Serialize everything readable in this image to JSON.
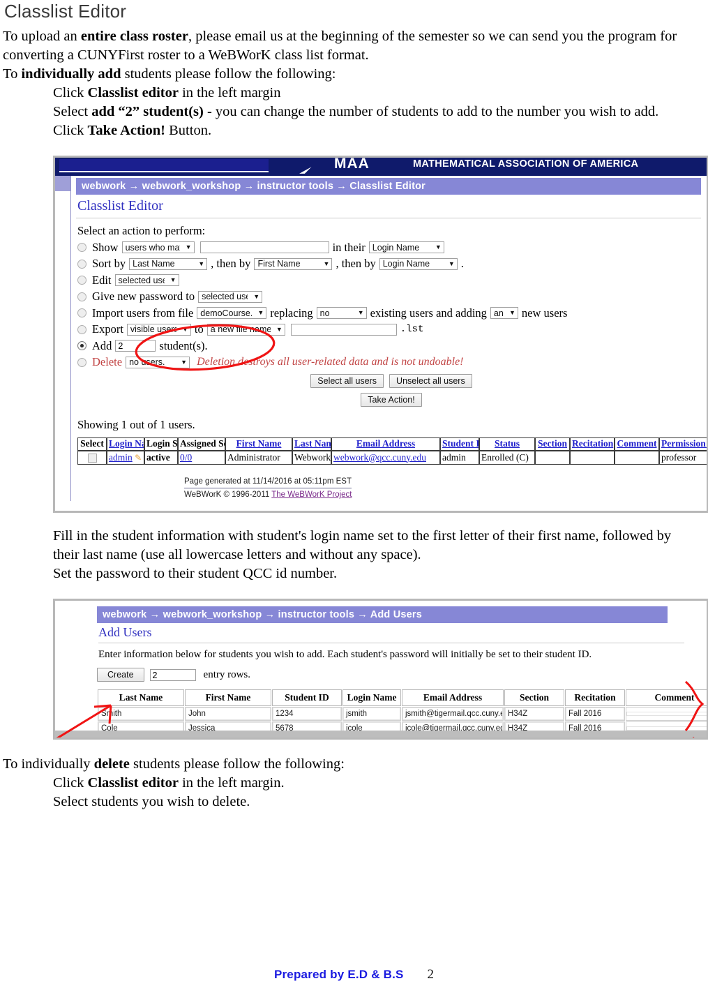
{
  "document": {
    "title": "Classlist Editor",
    "paragraphs": [
      {
        "id": "p1",
        "segments": [
          {
            "text": "To upload an ",
            "bold": false
          },
          {
            "text": "entire class roster",
            "bold": true
          },
          {
            "text": ", please email us at the beginning of the semester so we can send you the program for converting a CUNYFirst roster to a WeBWorK class list format.",
            "bold": false
          }
        ]
      },
      {
        "id": "p2",
        "segments": [
          {
            "text": "To ",
            "bold": false
          },
          {
            "text": "individually add",
            "bold": true
          },
          {
            "text": " students please follow the following:",
            "bold": false
          }
        ]
      },
      {
        "id": "p3",
        "indent": true,
        "segments": [
          {
            "text": "Click ",
            "bold": false
          },
          {
            "text": "Classlist editor",
            "bold": true
          },
          {
            "text": " in the left margin",
            "bold": false
          }
        ]
      },
      {
        "id": "p4",
        "indent": true,
        "segments": [
          {
            "text": "Select ",
            "bold": false
          },
          {
            "text": "add “2” student(s)",
            "bold": true
          },
          {
            "text": " - you can change the number of students to add to the number you wish to add.",
            "bold": false
          }
        ]
      },
      {
        "id": "p5",
        "indent": true,
        "segments": [
          {
            "text": "Click ",
            "bold": false
          },
          {
            "text": "Take Action!",
            "bold": true
          },
          {
            "text": " Button.",
            "bold": false
          }
        ]
      },
      {
        "id": "p6",
        "indent": true,
        "segments": [
          {
            "text": "Fill in the student information with student's login name set to the first letter of their first name, followed by their last name (use all lowercase letters and without any space).",
            "bold": false
          }
        ]
      },
      {
        "id": "p7",
        "indent": true,
        "segments": [
          {
            "text": "Set the password to their student QCC id number.",
            "bold": false
          }
        ]
      },
      {
        "id": "p8",
        "segments": [
          {
            "text": "To individually ",
            "bold": false
          },
          {
            "text": "delete",
            "bold": true
          },
          {
            "text": " students please follow the following:",
            "bold": false
          }
        ]
      },
      {
        "id": "p9",
        "indent": true,
        "segments": [
          {
            "text": "Click ",
            "bold": false
          },
          {
            "text": "Classlist editor",
            "bold": true
          },
          {
            "text": " in the left margin.",
            "bold": false
          }
        ]
      },
      {
        "id": "p10",
        "indent": true,
        "segments": [
          {
            "text": "Select students you wish to delete.",
            "bold": false
          }
        ]
      }
    ],
    "footer": {
      "prepared_by": "Prepared by E.D & B.S",
      "page_number": "2"
    }
  },
  "screenshot_classlist": {
    "banner": {
      "org_letters": "MAA",
      "org_name": "MATHEMATICAL ASSOCIATION OF AMERICA"
    },
    "breadcrumb": "webwork → webwork_workshop → instructor tools → Classlist Editor",
    "heading": "Classlist Editor",
    "prompt": "Select an action to perform:",
    "actions": {
      "show": {
        "label": "Show",
        "selected": false,
        "match_select": "users who match:",
        "search_value": "",
        "mid_label": "in their",
        "field_select": "Login Name"
      },
      "sort": {
        "label": "Sort by",
        "selected": false,
        "first_select": "Last Name",
        "then_label_1": ", then by",
        "second_select": "First Name",
        "then_label_2": ", then by",
        "third_select": "Login Name",
        "trailing": "."
      },
      "edit": {
        "label": "Edit",
        "selected": false,
        "target_select": "selected users"
      },
      "password": {
        "label": "Give new password to",
        "selected": false,
        "target_select": "selected users"
      },
      "import": {
        "label": "Import users from file",
        "selected": false,
        "file_select": "demoCourse.lst",
        "replacing_label": "replacing",
        "replacing_select": "no",
        "existing_label": "existing users and adding",
        "adding_select": "any",
        "new_users_label": "new users"
      },
      "export": {
        "label": "Export",
        "selected": false,
        "scope_select": "visible users",
        "to_label": "to",
        "dest_select": "a new file named:",
        "filename_value": "",
        "extension": ".lst"
      },
      "add": {
        "label": "Add",
        "selected": true,
        "count_value": "2",
        "suffix": "student(s)."
      },
      "delete": {
        "label": "Delete",
        "selected": false,
        "scope_select": "no users.",
        "warning": "Deletion destroys all user-related data and is not undoable!"
      }
    },
    "buttons": {
      "select_all": "Select all users",
      "unselect_all": "Unselect all users",
      "take_action": "Take Action!"
    },
    "showing": "Showing 1 out of 1 users.",
    "table": {
      "columns": [
        {
          "label": "Select",
          "link": false
        },
        {
          "label": "Login Name",
          "link": true
        },
        {
          "label": "Login Status",
          "link": false
        },
        {
          "label": "Assigned Sets",
          "link": false
        },
        {
          "label": "First Name",
          "link": true
        },
        {
          "label": "Last Name",
          "link": true
        },
        {
          "label": "Email Address",
          "link": true
        },
        {
          "label": "Student ID",
          "link": true
        },
        {
          "label": "Status",
          "link": true
        },
        {
          "label": "Section",
          "link": true
        },
        {
          "label": "Recitation",
          "link": true
        },
        {
          "label": "Comment",
          "link": true
        },
        {
          "label": "Permission Level",
          "link": true
        }
      ],
      "rows": [
        {
          "login_name": "admin",
          "login_status": "active",
          "assigned_sets": "0/0",
          "first_name": "Administrator",
          "last_name": "Webwork",
          "email": "webwork@qcc.cuny.edu",
          "student_id": "admin",
          "status": "Enrolled (C)",
          "section": "",
          "recitation": "",
          "comment": "",
          "permission_level": "professor"
        }
      ]
    },
    "footer": {
      "generated": "Page generated at 11/14/2016 at 05:11pm EST",
      "copyright": "WeBWorK © 1996-2011 ",
      "project_link": "The WeBWorK Project"
    }
  },
  "screenshot_addusers": {
    "breadcrumb": "webwork → webwork_workshop → instructor tools → Add Users",
    "heading": "Add Users",
    "note": "Enter information below for students you wish to add. Each student's password will initially be set to their student ID.",
    "create_button": "Create",
    "create_count": "2",
    "create_suffix": "entry rows.",
    "table": {
      "columns": [
        "Last Name",
        "First Name",
        "Student ID",
        "Login Name",
        "Email Address",
        "Section",
        "Recitation",
        "Comment"
      ],
      "rows": [
        {
          "last_name": "Smith",
          "first_name": "John",
          "student_id": "1234",
          "login_name": "jsmith",
          "email": "jsmith@tigermail.qcc.cuny.e",
          "section": "H34Z",
          "recitation": "Fall 2016",
          "comment": ""
        },
        {
          "last_name": "Cole",
          "first_name": "Jessica",
          "student_id": "5678",
          "login_name": "jcole",
          "email": "jcole@tigermail.qcc.cuny.ed",
          "section": "H34Z",
          "recitation": "Fall 2016",
          "comment": ""
        }
      ]
    }
  },
  "annotations": {
    "ink_color": "#f01414",
    "marks": [
      {
        "name": "circle-around-add-field",
        "shape": "ellipse"
      },
      {
        "name": "arrow-to-entry-rows",
        "shape": "arrow"
      },
      {
        "name": "brace-right-of-rows",
        "shape": "brace"
      }
    ]
  }
}
